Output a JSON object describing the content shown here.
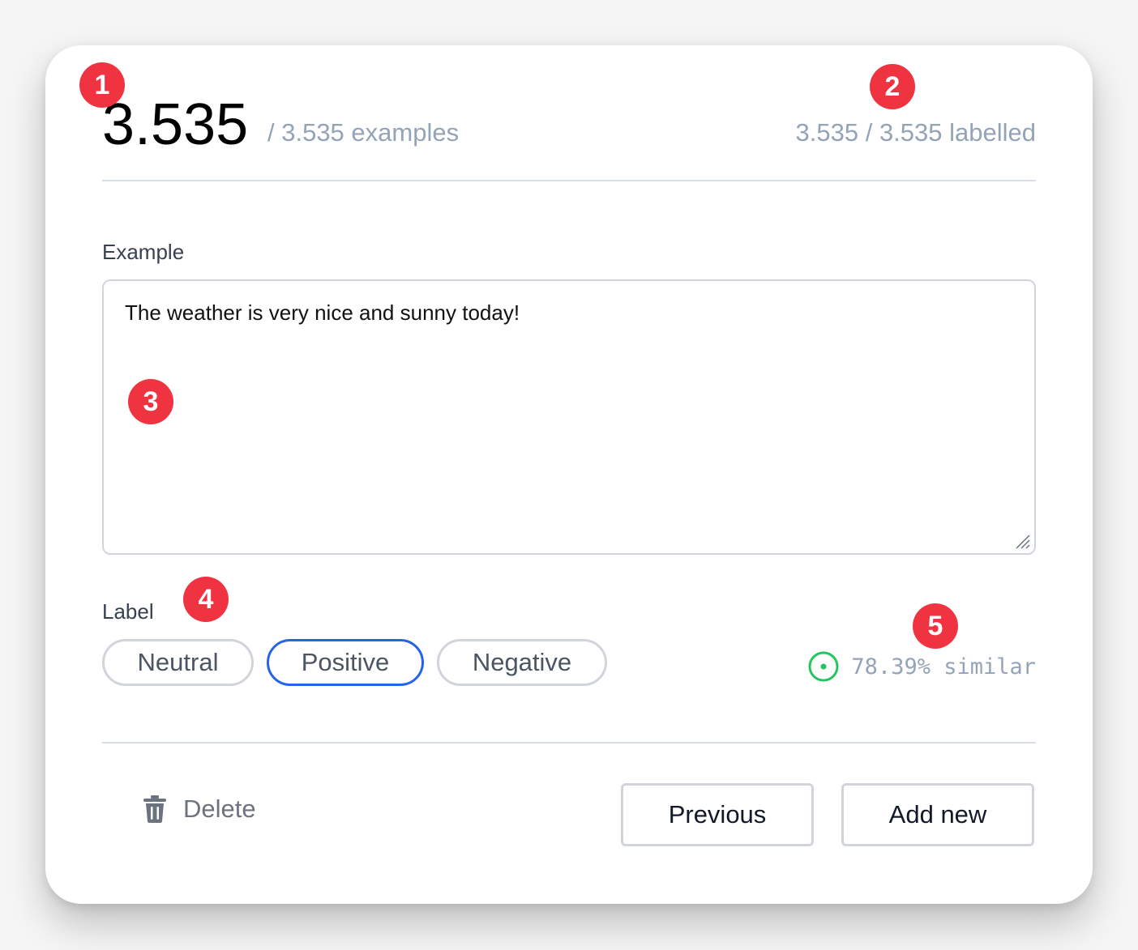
{
  "header": {
    "current_count": "3.535",
    "total_examples": "/ 3.535 examples",
    "labelled_status": "3.535 / 3.535 labelled"
  },
  "example": {
    "label": "Example",
    "text": "The weather is very nice and sunny today!"
  },
  "label_section": {
    "label": "Label",
    "options": [
      "Neutral",
      "Positive",
      "Negative"
    ],
    "selected": "Positive"
  },
  "similarity": {
    "text": "78.39% similar",
    "icon": "target-circle-icon",
    "color": "#22c55e"
  },
  "actions": {
    "delete_label": "Delete",
    "previous_label": "Previous",
    "add_new_label": "Add new"
  },
  "annotations": [
    "1",
    "2",
    "3",
    "4",
    "5"
  ],
  "colors": {
    "accent": "#2563eb",
    "muted_text": "#94a3b8",
    "badge": "#ef3340"
  }
}
